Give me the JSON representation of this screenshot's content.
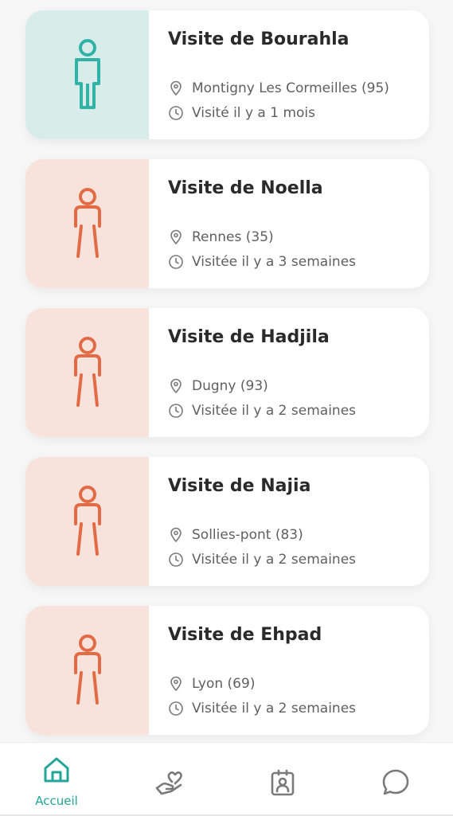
{
  "colors": {
    "accent": "#23a69a",
    "male_bg": "#d8ecea",
    "female_bg": "#f8e3dc",
    "female_icon": "#e26b46",
    "muted_icon": "#7a7a7a"
  },
  "visits": [
    {
      "title": "Visite de Bourahla",
      "location": "Montigny Les Cormeilles (95)",
      "time": "Visité il y a 1 mois",
      "avatar": "male-person-icon"
    },
    {
      "title": "Visite de Noella",
      "location": "Rennes (35)",
      "time": "Visitée il y a 3 semaines",
      "avatar": "female-person-icon"
    },
    {
      "title": "Visite de Hadjila",
      "location": "Dugny (93)",
      "time": "Visitée il y a 2 semaines",
      "avatar": "female-person-icon"
    },
    {
      "title": "Visite de Najia",
      "location": "Sollies-pont (83)",
      "time": "Visitée il y a 2 semaines",
      "avatar": "female-person-icon"
    },
    {
      "title": "Visite de Ehpad",
      "location": "Lyon (69)",
      "time": "Visitée il y a 2 semaines",
      "avatar": "female-person-icon"
    }
  ],
  "tabbar": {
    "home_label": "Accueil",
    "tabs": [
      "home-icon",
      "heart-hand-icon",
      "badge-icon",
      "chat-icon"
    ]
  }
}
